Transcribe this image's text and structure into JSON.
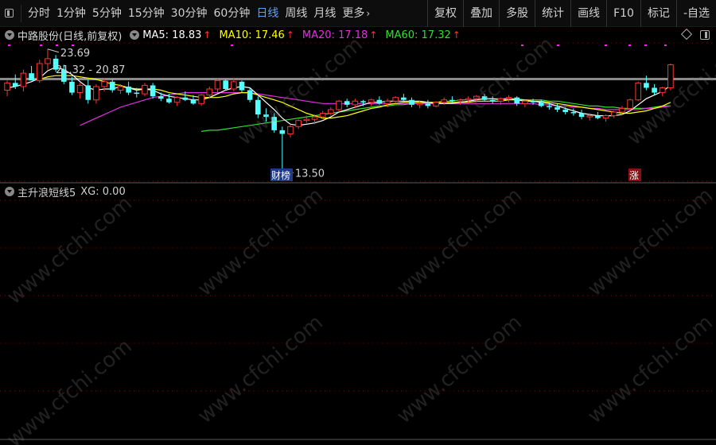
{
  "toolbar": {
    "periods": [
      "分时",
      "1分钟",
      "5分钟",
      "15分钟",
      "30分钟",
      "60分钟",
      "日线",
      "周线",
      "月线",
      "更多"
    ],
    "active_period": "日线",
    "more_arrow": "›",
    "right_buttons": [
      "复权",
      "叠加",
      "多股",
      "统计",
      "画线",
      "F10",
      "标记",
      "-自选"
    ]
  },
  "legend": {
    "stock": "中路股份(日线,前复权)",
    "ma": [
      {
        "label": "MA5: 18.83",
        "color": "#ffffff"
      },
      {
        "label": "MA10: 17.46",
        "color": "#ffff00"
      },
      {
        "label": "MA20: 17.18",
        "color": "#e030e0"
      },
      {
        "label": "MA60: 17.32",
        "color": "#30e030"
      }
    ],
    "up_arrow": "↑"
  },
  "indicator": {
    "name": "主升浪短线5",
    "value": "XG: 0.00"
  },
  "annotations": {
    "high": "23.69",
    "range": "21.32 - 20.87",
    "low": "13.50",
    "tag_left": "财榜",
    "tag_right": "涨"
  },
  "watermark": "www.cfchi.com",
  "colors": {
    "up": "#ff3232",
    "down": "#54ffff",
    "ma5": "#ffffff",
    "ma10": "#ffff00",
    "ma20": "#e030e0",
    "ma60": "#30e030",
    "grid": "#6a0000"
  },
  "chart_data": {
    "type": "candlestick",
    "ylim": [
      12.8,
      24.2
    ],
    "candles": [
      [
        20.3,
        21.1,
        19.8,
        20.9
      ],
      [
        20.9,
        21.6,
        20.4,
        20.6
      ],
      [
        20.6,
        22.0,
        20.2,
        21.7
      ],
      [
        21.7,
        22.3,
        21.2,
        21.1
      ],
      [
        21.1,
        22.8,
        20.9,
        22.5
      ],
      [
        22.5,
        23.69,
        22.0,
        22.9
      ],
      [
        22.9,
        23.2,
        21.8,
        22.0
      ],
      [
        22.0,
        22.4,
        20.8,
        21.0
      ],
      [
        21.0,
        21.4,
        19.9,
        20.1
      ],
      [
        20.1,
        20.9,
        19.6,
        20.7
      ],
      [
        20.7,
        21.2,
        19.2,
        19.5
      ],
      [
        19.5,
        20.8,
        19.2,
        20.6
      ],
      [
        20.6,
        21.3,
        20.2,
        21.0
      ],
      [
        21.0,
        21.2,
        20.1,
        20.3
      ],
      [
        20.3,
        20.8,
        20.0,
        20.6
      ],
      [
        20.6,
        21.0,
        19.9,
        20.1
      ],
      [
        20.1,
        20.5,
        19.7,
        20.0
      ],
      [
        20.0,
        20.9,
        19.8,
        20.7
      ],
      [
        20.7,
        20.9,
        19.6,
        19.8
      ],
      [
        19.8,
        20.1,
        19.4,
        19.6
      ],
      [
        19.6,
        20.0,
        19.2,
        19.3
      ],
      [
        19.3,
        19.8,
        19.0,
        19.7
      ],
      [
        19.7,
        20.2,
        19.4,
        19.5
      ],
      [
        19.5,
        19.9,
        19.1,
        19.2
      ],
      [
        19.2,
        20.0,
        19.0,
        19.9
      ],
      [
        19.9,
        20.6,
        19.6,
        20.4
      ],
      [
        20.4,
        21.3,
        20.1,
        21.1
      ],
      [
        21.1,
        21.2,
        20.3,
        20.4
      ],
      [
        20.4,
        21.3,
        20.2,
        21.0
      ],
      [
        21.0,
        21.1,
        20.1,
        20.3
      ],
      [
        20.3,
        20.5,
        19.3,
        19.5
      ],
      [
        19.5,
        19.8,
        18.0,
        18.3
      ],
      [
        18.3,
        18.8,
        17.7,
        18.1
      ],
      [
        18.1,
        18.4,
        16.8,
        17.0
      ],
      [
        17.0,
        17.3,
        13.5,
        16.7
      ],
      [
        16.7,
        17.5,
        16.4,
        17.3
      ],
      [
        17.3,
        17.9,
        17.1,
        17.8
      ],
      [
        17.8,
        18.2,
        17.6,
        17.9
      ],
      [
        17.9,
        18.3,
        17.5,
        18.1
      ],
      [
        18.1,
        18.6,
        17.9,
        18.4
      ],
      [
        18.4,
        18.9,
        18.2,
        18.7
      ],
      [
        18.7,
        19.5,
        18.5,
        19.4
      ],
      [
        19.4,
        19.6,
        18.9,
        19.1
      ],
      [
        19.1,
        19.6,
        18.9,
        19.4
      ],
      [
        19.4,
        19.5,
        19.0,
        19.3
      ],
      [
        19.3,
        19.6,
        19.0,
        19.5
      ],
      [
        19.5,
        19.8,
        19.1,
        19.2
      ],
      [
        19.2,
        19.6,
        18.9,
        19.4
      ],
      [
        19.4,
        19.8,
        19.2,
        19.7
      ],
      [
        19.7,
        20.0,
        19.3,
        19.5
      ],
      [
        19.5,
        19.7,
        18.9,
        19.1
      ],
      [
        19.1,
        19.4,
        18.8,
        19.2
      ],
      [
        19.2,
        19.5,
        18.8,
        19.0
      ],
      [
        19.0,
        19.4,
        18.9,
        19.3
      ],
      [
        19.3,
        19.7,
        19.1,
        19.5
      ],
      [
        19.5,
        19.8,
        19.2,
        19.4
      ],
      [
        19.4,
        19.6,
        19.1,
        19.5
      ],
      [
        19.5,
        19.8,
        19.2,
        19.6
      ],
      [
        19.6,
        19.9,
        19.3,
        19.8
      ],
      [
        19.8,
        20.0,
        19.4,
        19.5
      ],
      [
        19.5,
        19.8,
        19.2,
        19.4
      ],
      [
        19.4,
        19.7,
        19.1,
        19.6
      ],
      [
        19.6,
        19.9,
        19.3,
        19.7
      ],
      [
        19.7,
        19.8,
        19.0,
        19.2
      ],
      [
        19.2,
        19.5,
        18.9,
        19.4
      ],
      [
        19.4,
        19.6,
        19.1,
        19.3
      ],
      [
        19.3,
        19.5,
        18.9,
        19.0
      ],
      [
        19.0,
        19.3,
        18.7,
        18.9
      ],
      [
        18.9,
        19.2,
        18.5,
        18.7
      ],
      [
        18.7,
        18.9,
        18.3,
        18.5
      ],
      [
        18.5,
        18.8,
        18.2,
        18.4
      ],
      [
        18.4,
        18.7,
        17.9,
        18.1
      ],
      [
        18.1,
        18.4,
        17.8,
        18.2
      ],
      [
        18.2,
        18.5,
        17.9,
        18.0
      ],
      [
        18.0,
        18.3,
        17.7,
        18.2
      ],
      [
        18.2,
        18.6,
        18.0,
        18.5
      ],
      [
        18.5,
        19.0,
        18.3,
        18.8
      ],
      [
        18.8,
        19.6,
        18.6,
        19.5
      ],
      [
        19.5,
        21.0,
        19.4,
        20.9
      ],
      [
        20.9,
        21.5,
        20.3,
        20.5
      ],
      [
        20.5,
        20.8,
        19.9,
        20.1
      ],
      [
        20.1,
        20.6,
        19.8,
        20.5
      ],
      [
        20.5,
        22.5,
        20.3,
        22.4
      ]
    ],
    "ma5": [
      20.5,
      20.6,
      20.8,
      21.0,
      21.3,
      21.9,
      22.2,
      22.0,
      21.6,
      21.0,
      20.5,
      20.3,
      20.4,
      20.4,
      20.6,
      20.5,
      20.3,
      20.4,
      20.3,
      20.0,
      19.8,
      19.7,
      19.6,
      19.5,
      19.5,
      19.7,
      20.0,
      20.3,
      20.5,
      20.6,
      20.5,
      19.9,
      19.3,
      18.7,
      18.0,
      17.5,
      17.4,
      17.5,
      17.6,
      17.8,
      18.1,
      18.5,
      18.7,
      18.9,
      19.1,
      19.3,
      19.3,
      19.4,
      19.4,
      19.4,
      19.4,
      19.4,
      19.3,
      19.2,
      19.2,
      19.2,
      19.3,
      19.4,
      19.5,
      19.6,
      19.6,
      19.5,
      19.6,
      19.5,
      19.4,
      19.4,
      19.3,
      19.2,
      19.0,
      18.8,
      18.6,
      18.4,
      18.3,
      18.2,
      18.2,
      18.2,
      18.3,
      18.6,
      19.1,
      19.6,
      19.9,
      20.2,
      20.7
    ],
    "ma10": [
      null,
      null,
      null,
      null,
      21.2,
      21.4,
      21.5,
      21.5,
      21.5,
      21.4,
      21.3,
      21.2,
      21.0,
      20.8,
      20.7,
      20.5,
      20.4,
      20.4,
      20.4,
      20.3,
      20.1,
      20.0,
      19.9,
      19.8,
      19.7,
      19.7,
      19.7,
      19.8,
      20.0,
      20.1,
      20.1,
      19.9,
      19.7,
      19.5,
      19.3,
      19.0,
      18.7,
      18.4,
      18.2,
      18.0,
      18.0,
      18.1,
      18.2,
      18.4,
      18.6,
      18.8,
      18.9,
      19.1,
      19.2,
      19.3,
      19.3,
      19.3,
      19.3,
      19.3,
      19.3,
      19.3,
      19.3,
      19.3,
      19.4,
      19.4,
      19.4,
      19.4,
      19.5,
      19.5,
      19.5,
      19.4,
      19.4,
      19.3,
      19.2,
      19.1,
      19.0,
      18.9,
      18.8,
      18.7,
      18.6,
      18.5,
      18.4,
      18.4,
      18.5,
      18.6,
      18.8,
      19.0,
      19.3
    ],
    "ma20": [
      null,
      null,
      null,
      null,
      null,
      null,
      null,
      null,
      null,
      17.4,
      17.7,
      18.0,
      18.3,
      18.6,
      18.9,
      19.1,
      19.3,
      19.5,
      19.7,
      19.8,
      19.9,
      20.0,
      20.1,
      20.1,
      20.1,
      20.1,
      20.1,
      20.1,
      20.1,
      20.1,
      20.1,
      20.0,
      19.9,
      19.8,
      19.7,
      19.6,
      19.5,
      19.4,
      19.3,
      19.2,
      19.2,
      19.2,
      19.2,
      19.2,
      19.2,
      19.2,
      19.2,
      19.2,
      19.2,
      19.2,
      19.2,
      19.2,
      19.2,
      19.2,
      19.2,
      19.2,
      19.2,
      19.2,
      19.2,
      19.2,
      19.2,
      19.2,
      19.2,
      19.2,
      19.2,
      19.2,
      19.1,
      19.1,
      19.0,
      19.0,
      18.9,
      18.9,
      18.8,
      18.8,
      18.7,
      18.7,
      18.7,
      18.7,
      18.7,
      18.8,
      18.8,
      18.9,
      19.0
    ],
    "ma60": [
      null,
      null,
      null,
      null,
      null,
      null,
      null,
      null,
      null,
      null,
      null,
      null,
      null,
      null,
      null,
      null,
      null,
      null,
      null,
      null,
      null,
      null,
      null,
      null,
      16.9,
      17.0,
      17.0,
      17.1,
      17.2,
      17.3,
      17.4,
      17.5,
      17.6,
      17.7,
      17.8,
      17.9,
      18.0,
      18.1,
      18.2,
      18.3,
      18.4,
      18.5,
      18.6,
      18.7,
      18.8,
      18.9,
      19.0,
      19.0,
      19.1,
      19.1,
      19.2,
      19.2,
      19.3,
      19.3,
      19.4,
      19.4,
      19.5,
      19.5,
      19.5,
      19.6,
      19.6,
      19.6,
      19.6,
      19.6,
      19.5,
      19.5,
      19.5,
      19.4,
      19.4,
      19.3,
      19.2,
      19.1,
      19.0,
      19.0,
      18.9,
      18.9,
      18.8,
      18.8,
      18.8,
      18.8,
      18.9,
      19.0,
      19.0
    ]
  }
}
